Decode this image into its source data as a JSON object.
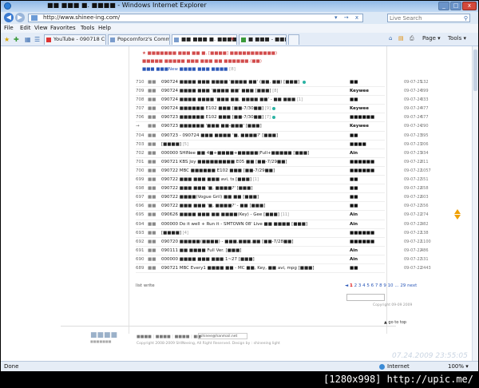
{
  "window": {
    "title": "■■ ■■■ ■. ■■■■ - Windows Internet Explorer",
    "minimize": "_",
    "maximize": "□",
    "close": "x"
  },
  "address": {
    "url": "http://www.shinee-ing.com/",
    "tail": "▾ → x",
    "search_placeholder": "Live Search"
  },
  "menu": [
    "File",
    "Edit",
    "View",
    "Favorites",
    "Tools",
    "Help"
  ],
  "tabs": [
    {
      "label": "YouTube - 090718 Cute So...",
      "active": false
    },
    {
      "label": "Popcornforz's Community-...",
      "active": false
    },
    {
      "label": "■■ ■■■ ■. ■■■■",
      "active": true
    },
    {
      "label": "■ ■■■ - ■■■",
      "active": false
    }
  ],
  "commands": {
    "page": "Page ▾",
    "tools": "Tools ▾"
  },
  "notices": [
    {
      "text": "★ ■■■■■■■ ■■■ ■■ ■, [■■■■] ■■■■■■■■■■■)",
      "count": "",
      "color": "red"
    },
    {
      "text": "■■■■■ ■■■■■ ■■■ ■■■ ■■ ■■■■■■.(■■)",
      "count": "",
      "color": "red"
    },
    {
      "text": "■■■ ■■■New ■■■■ ■■■ ■■■■",
      "count": "[8]",
      "color": "blue"
    }
  ],
  "posts": [
    {
      "num": "710",
      "cat": "■■",
      "subject": "090724 ■■■■ ■■■ ■■■■ '■■■■ ■■' (■■, ■■) [■■■]",
      "comments": "",
      "dot": true,
      "author": "■■",
      "date": "09-07-25",
      "hits": "132"
    },
    {
      "num": "709",
      "cat": "■■",
      "subject": "090724 ■■■■ ■■■ '■■■■ ■■' ■■■ [■■■]",
      "comments": "[8]",
      "dot": false,
      "author": "Keywee",
      "date": "09-07-24",
      "hits": "399"
    },
    {
      "num": "708",
      "cat": "■■",
      "subject": "090724 ■■■■ ■■■■ '■■■ ■■, ■■■■ ■■' - ■■ ■■■",
      "comments": "[1]",
      "dot": false,
      "author": "■■",
      "date": "09-07-24",
      "hits": "333"
    },
    {
      "num": "707",
      "cat": "■■",
      "subject": "090724 ■■■■■■ E102 ■■■ [■■-7/30■■]",
      "comments": "[9]",
      "dot": true,
      "author": "Keywee",
      "date": "09-07-24",
      "hits": "477"
    },
    {
      "num": "706",
      "cat": "■■",
      "subject": "090723 ■■■■■■ E102 ■■■ [■■-7/30■■]",
      "comments": "[7]",
      "dot": true,
      "author": "■■■■■■",
      "date": "09-07-24",
      "hits": "677"
    },
    {
      "num": "→",
      "cat": "■■",
      "subject": "090723 ■■■■■■ '■■■ ■■-■■■' [■■■]",
      "comments": "",
      "dot": false,
      "author": "Keywee",
      "date": "09-07-24",
      "hits": "290"
    },
    {
      "num": "704",
      "cat": "■■",
      "subject": "090723 - 090724 ■■■ ■■■■ '■, ■■■■?' [■■■]",
      "comments": "",
      "dot": false,
      "author": "■■",
      "date": "09-07-23",
      "hits": "395"
    },
    {
      "num": "703",
      "cat": "■■",
      "subject": "[■■■■]",
      "comments": "[5]",
      "dot": false,
      "author": "■■■■",
      "date": "09-07-23",
      "hits": "206"
    },
    {
      "num": "702",
      "cat": "■■",
      "subject": "000000 SHINee ■■ 4■+■■■■+■■■■■(Full+■■■■■ [■■■]",
      "comments": "",
      "dot": false,
      "author": "Ain",
      "date": "09-07-23",
      "hits": "934"
    },
    {
      "num": "701",
      "cat": "■■",
      "subject": "090721 KBS Joy ■■■■■■■■■ E05 ■■ [■■-7/29■■]",
      "comments": "",
      "dot": false,
      "author": "■■■■■■",
      "date": "09-07-22",
      "hits": "811"
    },
    {
      "num": "700",
      "cat": "■■",
      "subject": "090722 MBC ■■■■■■ E102 ■■■ [■■-7/29■■]",
      "comments": "",
      "dot": false,
      "author": "■■■■■■",
      "date": "09-07-22",
      "hits": "1057"
    },
    {
      "num": "699",
      "cat": "■■",
      "subject": "090722 ■■■ ■■■ ■■■ avi, ts [■■■]",
      "comments": "[1]",
      "dot": false,
      "author": "■■",
      "date": "09-07-22",
      "hits": "551"
    },
    {
      "num": "698",
      "cat": "■■",
      "subject": "090722 ■■■ ■■■ '■, ■■■■?' [■■■]",
      "comments": "",
      "dot": false,
      "author": "■■",
      "date": "09-07-22",
      "hits": "658"
    },
    {
      "num": "697",
      "cat": "■■",
      "subject": "090722 ■■■■(Vogue Gril) ■■ ■■ [■■■]",
      "comments": "",
      "dot": false,
      "author": "■■",
      "date": "09-07-22",
      "hits": "603"
    },
    {
      "num": "696",
      "cat": "■■",
      "subject": "090722 ■■■ ■■■ '■, ■■■■?' - ■■ [■■■]",
      "comments": "",
      "dot": false,
      "author": "■■",
      "date": "09-07-22",
      "hits": "556"
    },
    {
      "num": "695",
      "cat": "■■",
      "subject": "090626 ■■■■ ■■■ ■■ ■■■■(Key) - Gee [■■■]",
      "comments": "[11]",
      "dot": false,
      "author": "Ain",
      "date": "09-07-22",
      "hits": "274"
    },
    {
      "num": "694",
      "cat": "■■",
      "subject": "000000 Do it well + Run it - SMTOWN 08' Live ■■ ■■■■ [■■■]",
      "comments": "",
      "dot": false,
      "author": "Ain",
      "date": "09-07-22",
      "hits": "982"
    },
    {
      "num": "693",
      "cat": "■■",
      "subject": "[■■■■]",
      "comments": "[4]",
      "dot": false,
      "author": "■■■■■■",
      "date": "09-07-22",
      "hits": "138"
    },
    {
      "num": "692",
      "cat": "■■",
      "subject": "090720 ■■■■■(■■■■) - ■■■,■■■,■■ [■■-7/28■■]",
      "comments": "",
      "dot": false,
      "author": "■■■■■■",
      "date": "09-07-22",
      "hits": "1100"
    },
    {
      "num": "691",
      "cat": "■■",
      "subject": "090111 ■■ ■■■■ Full Ver. [■■■]",
      "comments": "",
      "dot": false,
      "author": "Ain",
      "date": "09-07-22",
      "hits": "486"
    },
    {
      "num": "690",
      "cat": "■■",
      "subject": "000000 ■■■■ ■■■ ■■■ 1~27 [■■■]",
      "comments": "",
      "dot": false,
      "author": "Ain",
      "date": "09-07-22",
      "hits": "531"
    },
    {
      "num": "689",
      "cat": "■■",
      "subject": "090721 MBC Every1 ■■■■ ■■ - MC ■■, Key, ■■ avi, mpg [■■■]",
      "comments": "",
      "dot": false,
      "author": "■■",
      "date": "09-07-22",
      "hits": "2443"
    }
  ],
  "list_footer": {
    "list_label": "list",
    "write_label": "write",
    "pages": [
      "1",
      "2",
      "3",
      "4",
      "5",
      "6",
      "7",
      "8",
      "9",
      "10"
    ],
    "current_page": "1",
    "prev": "◄",
    "ellipsis": "...",
    "last_page": "29",
    "next": "next"
  },
  "site_copyright_small": "Copyright 09-09 2009",
  "go_to_top": "▲ go to top",
  "footer": {
    "logo_text": "■■■■",
    "logo_sub": "■■■■■■■",
    "links": [
      "■■■■",
      "■■■■",
      "■■■■",
      "■■"
    ],
    "email": "shinee@hanmail.net",
    "copyright": "Copyright 2008-2009 SHINeeing, All Right Reserved. Design by : shineeing light"
  },
  "watermark_time": "07.24.2009 23:55:05",
  "status": {
    "left": "Done",
    "zone": "Internet",
    "zoom": "100% ▾"
  },
  "overlay_text": "[1280x998] http://upic.me/"
}
